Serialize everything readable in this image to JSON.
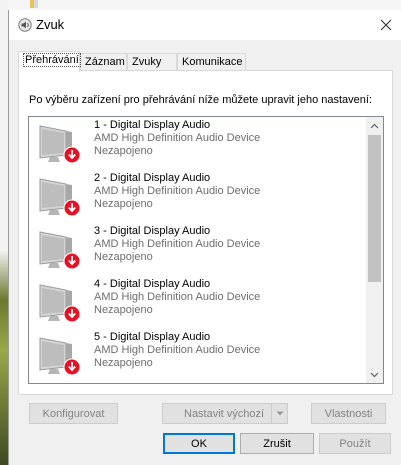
{
  "window": {
    "title": "Zvuk",
    "icon": "speaker-icon"
  },
  "tabs": [
    {
      "label": "Přehrávání",
      "active": true
    },
    {
      "label": "Záznam",
      "active": false
    },
    {
      "label": "Zvuky",
      "active": false
    },
    {
      "label": "Komunikace",
      "active": false
    }
  ],
  "panel": {
    "instruction": "Po výběru zařízení pro přehrávání níže můžete upravit jeho nastavení:"
  },
  "devices": [
    {
      "name": "1 - Digital Display Audio",
      "driver": "AMD High Definition Audio Device",
      "status": "Nezapojeno",
      "icon": "monitor-disconnected-icon"
    },
    {
      "name": "2 - Digital Display Audio",
      "driver": "AMD High Definition Audio Device",
      "status": "Nezapojeno",
      "icon": "monitor-disconnected-icon"
    },
    {
      "name": "3 - Digital Display Audio",
      "driver": "AMD High Definition Audio Device",
      "status": "Nezapojeno",
      "icon": "monitor-disconnected-icon"
    },
    {
      "name": "4 - Digital Display Audio",
      "driver": "AMD High Definition Audio Device",
      "status": "Nezapojeno",
      "icon": "monitor-disconnected-icon"
    },
    {
      "name": "5 - Digital Display Audio",
      "driver": "AMD High Definition Audio Device",
      "status": "Nezapojeno",
      "icon": "monitor-disconnected-icon"
    }
  ],
  "buttons": {
    "configure": "Konfigurovat",
    "set_default": "Nastavit výchozí",
    "properties": "Vlastnosti",
    "ok": "OK",
    "cancel": "Zrušit",
    "apply": "Použít"
  },
  "colors": {
    "accent": "#0078d7",
    "disconnect_badge": "#e81123",
    "disabled_text": "#838383"
  }
}
